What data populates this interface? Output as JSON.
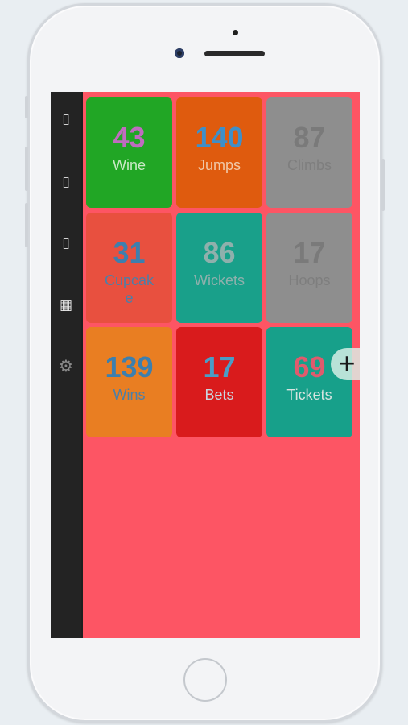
{
  "sidebar": {
    "icons": [
      {
        "name": "page-icon",
        "glyph": "▯"
      },
      {
        "name": "page-icon",
        "glyph": "▯"
      },
      {
        "name": "page-icon",
        "glyph": "▯"
      },
      {
        "name": "calculator-icon",
        "glyph": "▦"
      },
      {
        "name": "gear-icon",
        "glyph": "⚙"
      }
    ]
  },
  "colors": {
    "background": "#fd5564",
    "sidebar": "#232323"
  },
  "tiles": [
    {
      "value": "43",
      "label": "Wine",
      "bg": "#21a625",
      "value_color": "#c06cc0",
      "label_color": "#c8e8c4"
    },
    {
      "value": "140",
      "label": "Jumps",
      "bg": "#df5b0e",
      "value_color": "#3f8fc8",
      "label_color": "#f0c8a8"
    },
    {
      "value": "87",
      "label": "Climbs",
      "bg": "#8e8e8e",
      "value_color": "#7a7a7a",
      "label_color": "#7e7e7e"
    },
    {
      "value": "31",
      "label": "Cupcake",
      "bg": "#e8503f",
      "value_color": "#3d7fae",
      "label_color": "#4b7fa8"
    },
    {
      "value": "86",
      "label": "Wickets",
      "bg": "#19a08a",
      "value_color": "#8fb0ac",
      "label_color": "#8fb0ac"
    },
    {
      "value": "17",
      "label": "Hoops",
      "bg": "#8e8e8e",
      "value_color": "#7a7a7a",
      "label_color": "#7e7e7e"
    },
    {
      "value": "139",
      "label": "Wins",
      "bg": "#e97e22",
      "value_color": "#3d7fae",
      "label_color": "#4b7fa8"
    },
    {
      "value": "17",
      "label": "Bets",
      "bg": "#d91b1c",
      "value_color": "#4a9dc6",
      "label_color": "#c9d6e0"
    },
    {
      "value": "69",
      "label": "Tickets",
      "bg": "#17a08a",
      "value_color": "#e05b6d",
      "label_color": "#d7e4e0"
    }
  ],
  "add_button": {
    "label": "+"
  }
}
